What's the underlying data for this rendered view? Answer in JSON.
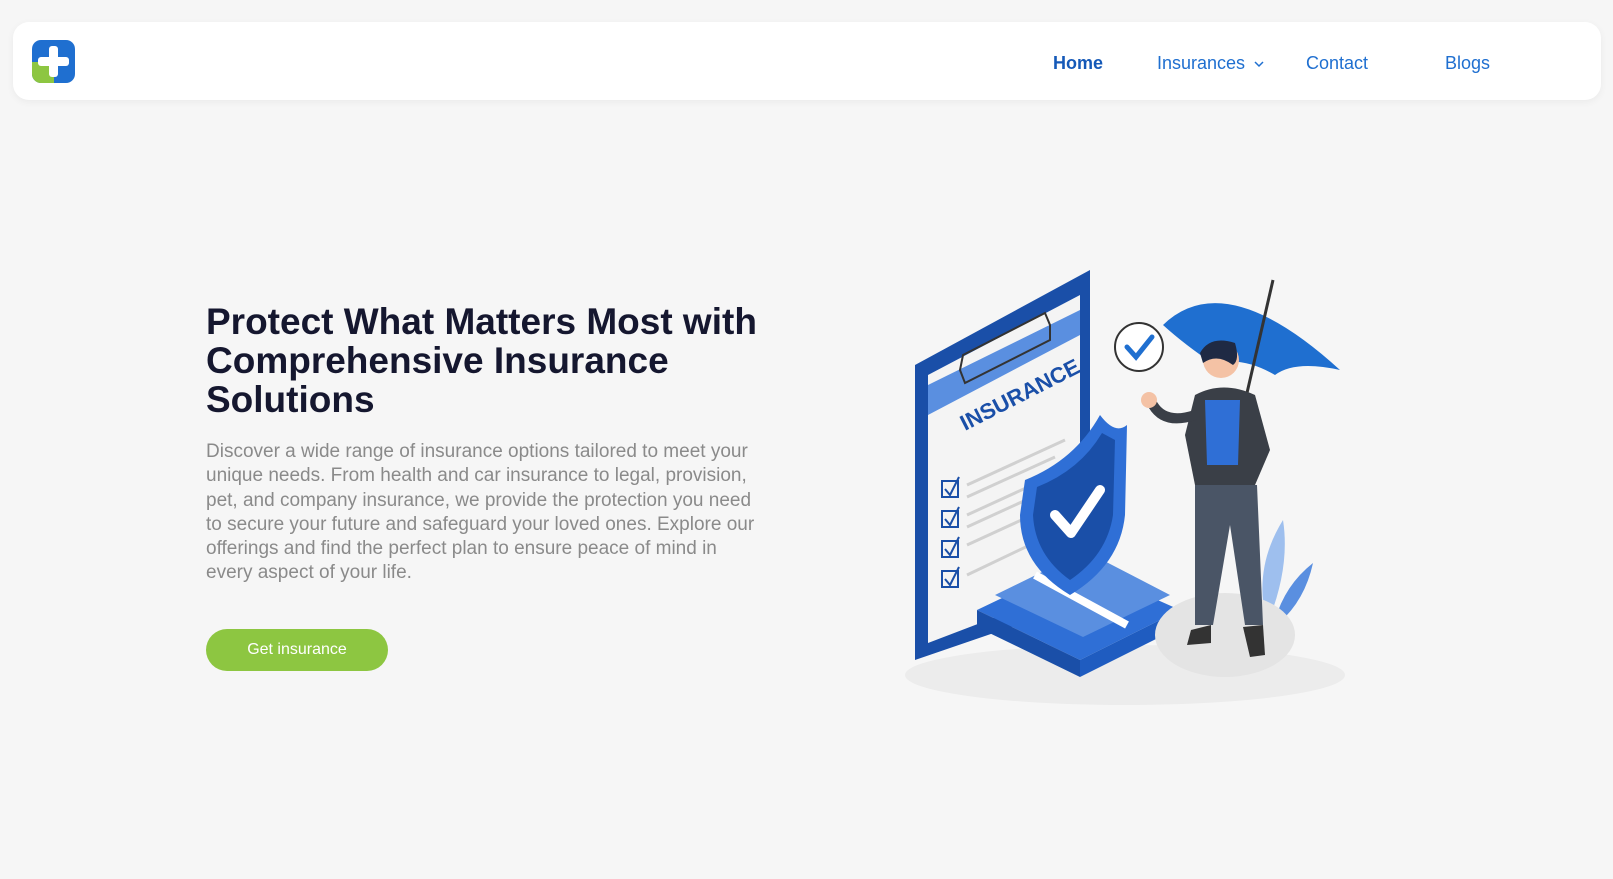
{
  "brand": {
    "logo_icon": "medical-cross-logo",
    "colors": {
      "blue": "#1f6fd0",
      "green": "#8dc641"
    }
  },
  "nav": {
    "home": "Home",
    "insurances": "Insurances",
    "contact": "Contact",
    "blogs": "Blogs"
  },
  "hero": {
    "title": "Protect What Matters Most with Comprehensive Insurance Solutions",
    "description": "Discover a wide range of insurance options tailored to meet your unique needs. From health and car insurance to legal, provision, pet, and company insurance, we provide the protection you need to secure your future and safeguard your loved ones. Explore our offerings and find the perfect plan to ensure peace of mind in every aspect of your life.",
    "cta_label": "Get insurance"
  },
  "illustration": {
    "document_label": "INSURANCE",
    "icons": [
      "clipboard-icon",
      "shield-check-icon",
      "money-stack-icon",
      "person-with-umbrella",
      "check-bubble-icon",
      "plant-icon"
    ]
  }
}
